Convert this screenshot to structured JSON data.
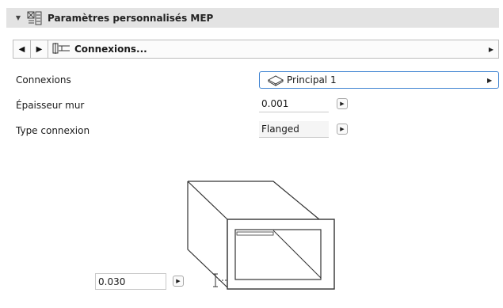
{
  "panel": {
    "title": "Paramètres personnalisés MEP",
    "collapse_icon": "triangle-down-icon",
    "header_icon": "custom-settings-icon"
  },
  "nav": {
    "prev_icon": "arrow-left-icon",
    "next_icon": "arrow-right-icon",
    "page_icon": "connection-icon",
    "page_label": "Connexions...",
    "dropdown_icon": "triangle-right-icon"
  },
  "fields": {
    "connexions_label": "Connexions",
    "connexions_value": "Principal 1",
    "connexions_icon": "cube-icon",
    "epaisseur_label": "Épaisseur mur",
    "epaisseur_value": "0.001",
    "type_label": "Type connexion",
    "type_value": "Flanged",
    "flange_value": "0.030"
  },
  "colors": {
    "header_bg": "#e3e3e3",
    "select_border": "#3d82d1"
  }
}
